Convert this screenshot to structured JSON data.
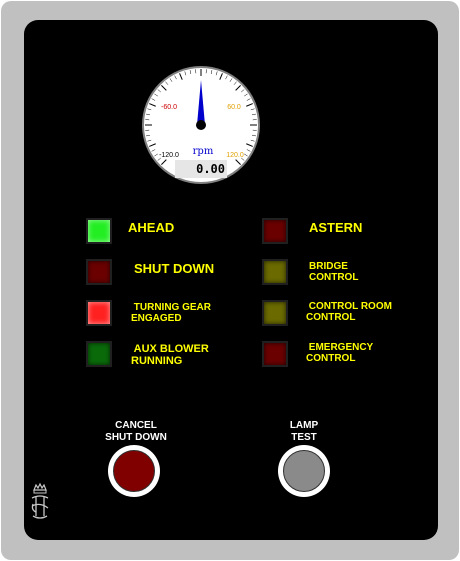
{
  "gauge": {
    "unit": "rpm",
    "value": 0.0,
    "readout": "0.00",
    "ticks": {
      "upper_left": "-60.0",
      "upper_right": "60.0",
      "lower_left": "-120.0",
      "lower_right": "120.0"
    },
    "colors": {
      "negative": "#cc0000",
      "positive": "#e0a000",
      "needle": "#0000cc"
    }
  },
  "lamps": [
    {
      "id": "ahead",
      "label": "AHEAD",
      "color": "#22ee22",
      "state": "on",
      "size": "big"
    },
    {
      "id": "astern",
      "label": "ASTERN",
      "color": "#6a0000",
      "state": "off",
      "size": "big"
    },
    {
      "id": "shut-down",
      "label": "SHUT DOWN",
      "color": "#6a0000",
      "state": "off",
      "size": "big"
    },
    {
      "id": "bridge-control",
      "label": "BRIDGE\nCONTROL",
      "color": "#6a6a00",
      "state": "off",
      "size": "small"
    },
    {
      "id": "turning-gear",
      "label": " TURNING GEAR\nENGAGED",
      "color": "#ff2020",
      "state": "on",
      "size": "small"
    },
    {
      "id": "control-room",
      "label": " CONTROL ROOM\nCONTROL",
      "color": "#6a6a00",
      "state": "off",
      "size": "small"
    },
    {
      "id": "aux-blower",
      "label": " AUX BLOWER\nRUNNING",
      "color": "#0a6a0a",
      "state": "off",
      "size": "small"
    },
    {
      "id": "emergency",
      "label": " EMERGENCY\nCONTROL",
      "color": "#6a0000",
      "state": "off",
      "size": "small"
    }
  ],
  "buttons": {
    "cancel": {
      "label": "CANCEL\nSHUT DOWN",
      "color": "#800000"
    },
    "lamp_test": {
      "label": "LAMP\nTEST",
      "color": "#8a8a8a"
    }
  }
}
